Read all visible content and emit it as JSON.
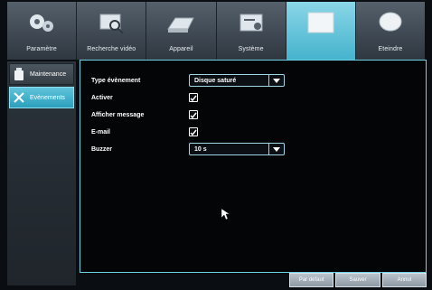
{
  "tabs": [
    {
      "label": "Paramètre",
      "icon": "gears-icon",
      "active": false
    },
    {
      "label": "Recherche vidéo",
      "icon": "video-search-icon",
      "active": false
    },
    {
      "label": "Appareil",
      "icon": "hard-drive-icon",
      "active": false
    },
    {
      "label": "Système",
      "icon": "system-icon",
      "active": false
    },
    {
      "label": "",
      "icon": "blank-screen-icon",
      "active": true
    },
    {
      "label": "Eteindre",
      "icon": "power-icon",
      "active": false
    }
  ],
  "sidebar": {
    "items": [
      {
        "label": "Maintenance",
        "icon": "usb-drive-icon",
        "active": false
      },
      {
        "label": "Evènements",
        "icon": "tools-icon",
        "active": true
      }
    ]
  },
  "form": {
    "event_type": {
      "label": "Type évènement",
      "value": "Disque saturé"
    },
    "enable": {
      "label": "Activer",
      "checked": true
    },
    "show_message": {
      "label": "Afficher message",
      "checked": true
    },
    "email": {
      "label": "E-mail",
      "checked": true
    },
    "buzzer": {
      "label": "Buzzer",
      "value": "10 s"
    }
  },
  "buttons": {
    "default_label": "Par défaut",
    "save_label": "Sauver",
    "cancel_label": "Annul"
  },
  "colors": {
    "accent": "#46b3cd",
    "panel_border": "#6fd2e4",
    "background": "#040507"
  }
}
